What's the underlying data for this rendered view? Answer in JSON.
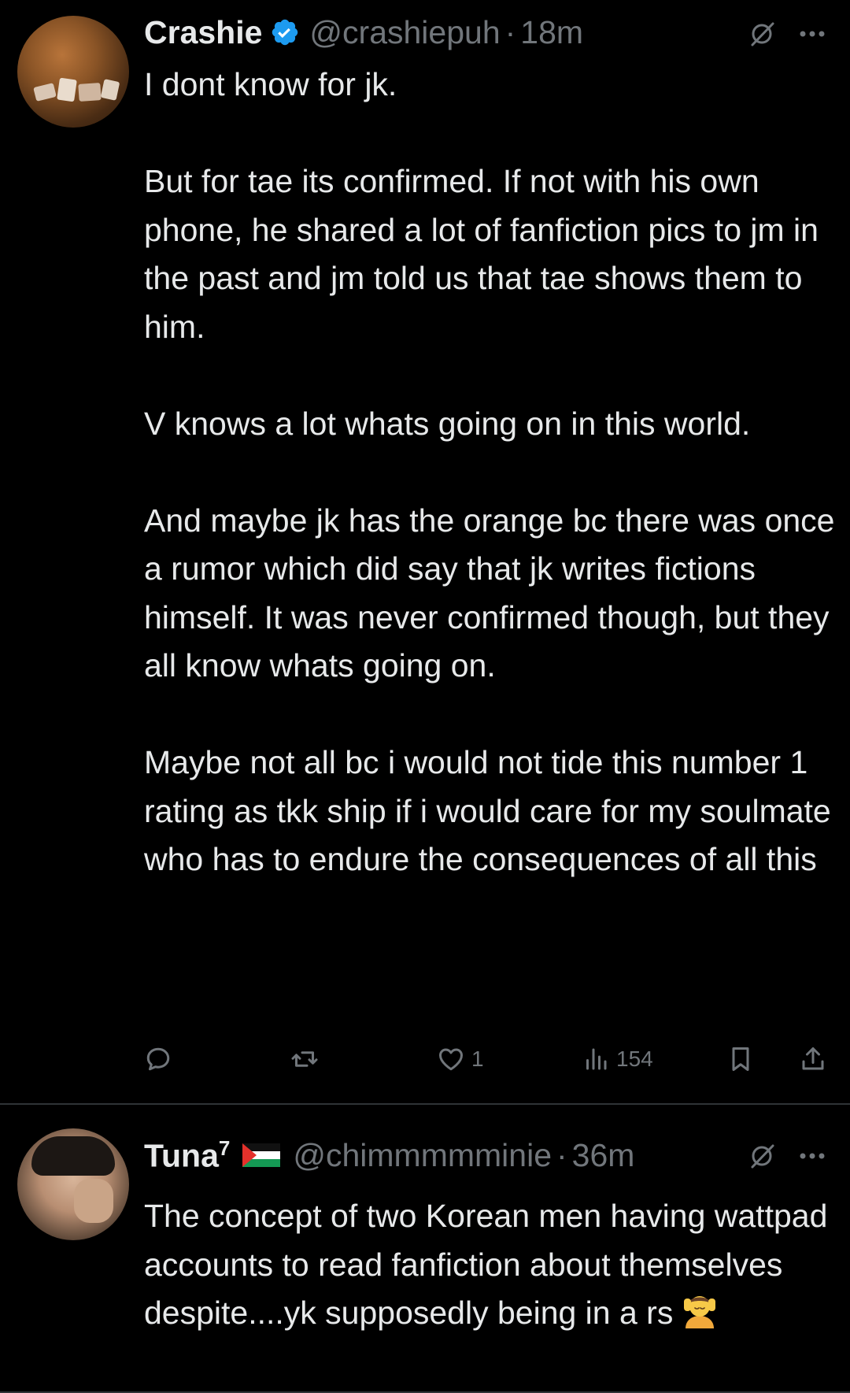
{
  "colors": {
    "background": "#000000",
    "text_primary": "#e7e9ea",
    "text_secondary": "#71767b",
    "divider": "#2f3336",
    "verified_badge": "#1d9bf0"
  },
  "tweets": [
    {
      "display_name": "Crashie",
      "verified": true,
      "handle": "@crashiepuh",
      "separator": "·",
      "time": "18m",
      "text": "I dont know for jk.\n\nBut for tae its confirmed. If not with his own phone, he shared a lot of fanfiction pics to jm in the past and jm told us that tae shows them to him.\n\nV knows a lot whats going on in this world.\n\nAnd maybe jk has the orange bc there was once a rumor which did say that jk writes fictions himself. It was never confirmed though, but they all know whats going on.\n\nMaybe not all bc i would not tide this number 1 rating as tkk ship if i would care for my soulmate who has to endure the consequences of all this",
      "actions": {
        "reply_icon": "reply-icon",
        "retweet_icon": "retweet-icon",
        "like_icon": "heart-icon",
        "like_count": "1",
        "views_icon": "views-icon",
        "views_count": "154",
        "bookmark_icon": "bookmark-icon",
        "share_icon": "share-icon"
      }
    },
    {
      "display_name": "Tuna",
      "name_superscript": "7",
      "flag": "palestine-flag",
      "handle": "@chimmmmminie",
      "separator": "·",
      "time": "36m",
      "text": "The concept of two Korean men having wattpad accounts to read fanfiction about themselves despite....yk supposedly being in a rs",
      "emoji": "person-getting-massage-emoji"
    }
  ]
}
